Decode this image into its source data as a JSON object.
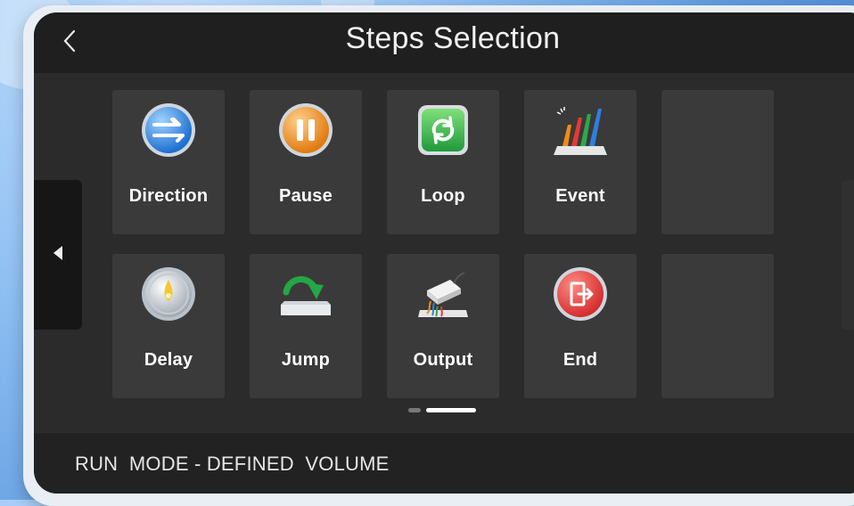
{
  "header": {
    "title": "Steps Selection"
  },
  "steps": [
    {
      "label": "Direction",
      "icon": "direction-icon"
    },
    {
      "label": "Pause",
      "icon": "pause-icon"
    },
    {
      "label": "Loop",
      "icon": "loop-icon"
    },
    {
      "label": "Event",
      "icon": "event-icon"
    },
    {
      "label": "Delay",
      "icon": "delay-icon"
    },
    {
      "label": "Jump",
      "icon": "jump-icon"
    },
    {
      "label": "Output",
      "icon": "output-icon"
    },
    {
      "label": "End",
      "icon": "end-icon"
    }
  ],
  "pagination": {
    "pages": 2,
    "current": 2
  },
  "status_bar": {
    "text": "RUN  MODE - DEFINED  VOLUME"
  },
  "colors": {
    "direction": "#2f8ee8",
    "pause": "#f08a1a",
    "loop": "#27a844",
    "end": "#e53935",
    "tile_bg": "#3a3a3a",
    "screen_bg": "#2b2b2b"
  }
}
